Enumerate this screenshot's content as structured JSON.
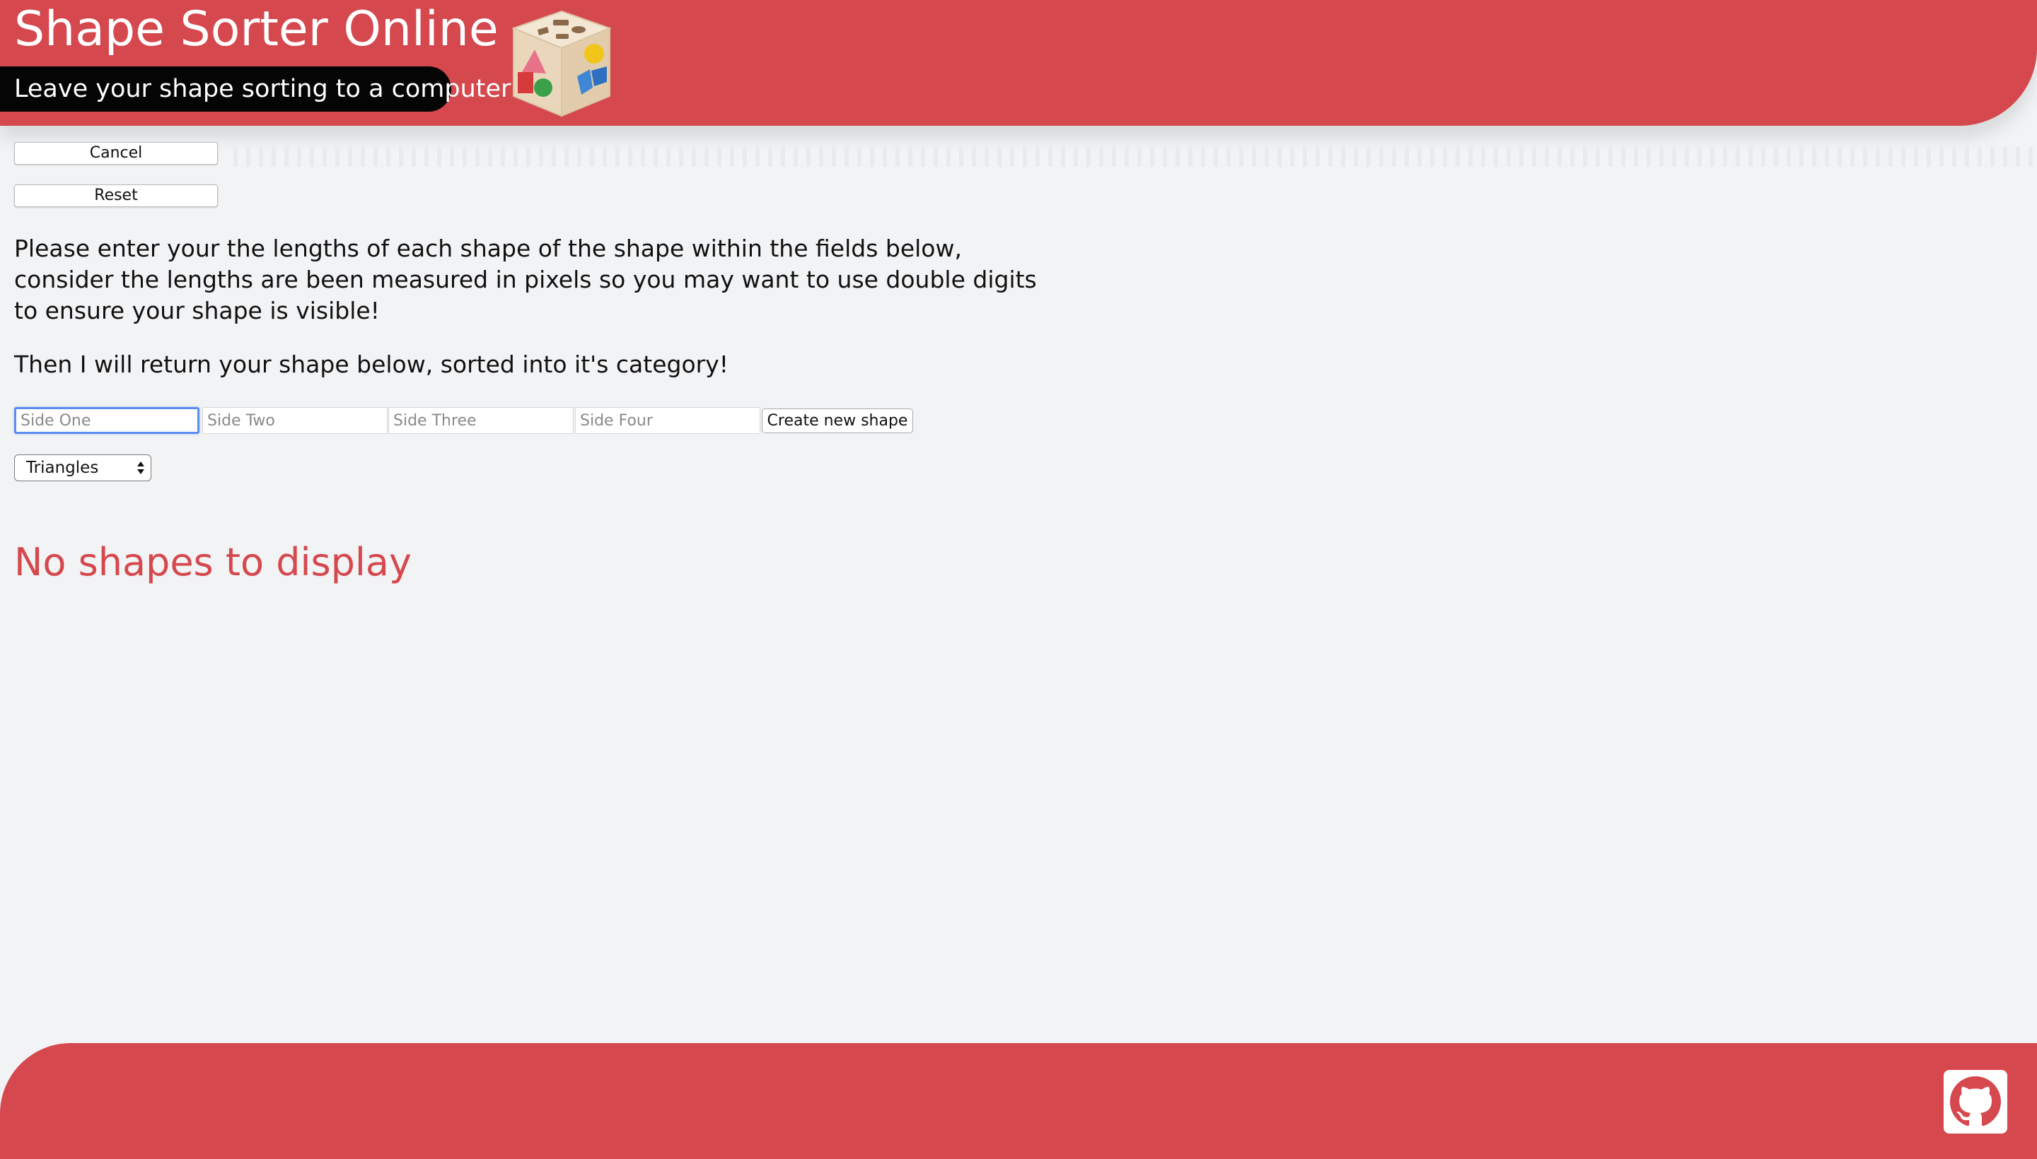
{
  "header": {
    "title": "Shape Sorter Online",
    "tagline": "Leave your shape sorting to a computer",
    "logo_icon": "shape-sorter-cube-icon"
  },
  "controls": {
    "cancel_label": "Cancel",
    "reset_label": "Reset"
  },
  "instructions": {
    "paragraph1": "Please enter your the lengths of each shape of the shape within the fields below, consider the lengths are been measured in pixels so you may want to use double digits to ensure your shape is visible!",
    "paragraph2": "Then I will return your shape below, sorted into it's category!"
  },
  "form": {
    "side_one": {
      "value": "",
      "placeholder": "Side One"
    },
    "side_two": {
      "value": "",
      "placeholder": "Side Two"
    },
    "side_three": {
      "value": "",
      "placeholder": "Side Three"
    },
    "side_four": {
      "value": "",
      "placeholder": "Side Four"
    },
    "create_label": "Create new shape"
  },
  "filter": {
    "selected": "Triangles"
  },
  "results": {
    "empty_message": "No shapes to display"
  },
  "footer": {
    "github_icon": "github-icon"
  },
  "colors": {
    "brand_red": "#d5484e",
    "background": "#f2f3f5",
    "focus_blue": "#5b8def"
  }
}
